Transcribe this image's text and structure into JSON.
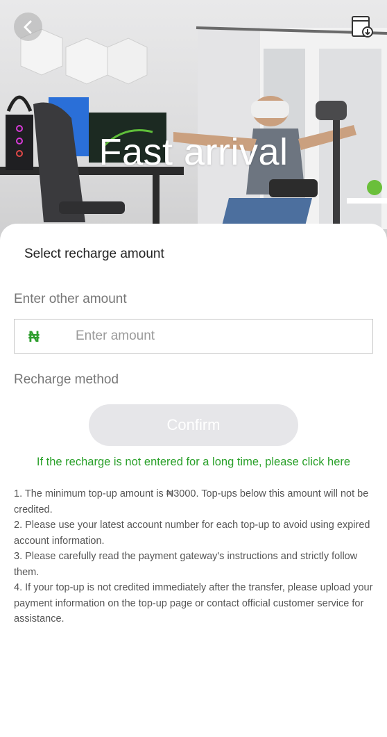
{
  "hero": {
    "title": "Fast arrival"
  },
  "icons": {
    "back": "chevron-left-icon",
    "download": "download-icon"
  },
  "form": {
    "section_title": "Select recharge amount",
    "other_amount_label": "Enter other amount",
    "currency_symbol": "₦",
    "amount_placeholder": "Enter amount",
    "amount_value": "",
    "method_label": "Recharge method",
    "confirm_label": "Confirm",
    "help_link": "If the recharge is not entered for a long time, please click here"
  },
  "notes": [
    "1. The minimum top-up amount is ₦3000. Top-ups below this amount will not be credited.",
    "2. Please use your latest account number for each top-up to avoid using expired account information.",
    "3. Please carefully read the payment gateway's instructions and strictly follow them.",
    "4. If your top-up is not credited immediately after the transfer, please upload your payment information on the top-up page or contact official customer service for assistance."
  ],
  "colors": {
    "accent_green": "#2aa02a",
    "confirm_disabled_bg": "#e6e6e9"
  }
}
